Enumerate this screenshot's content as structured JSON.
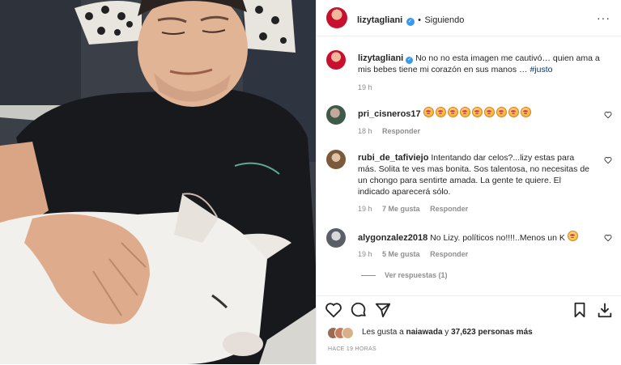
{
  "post": {
    "username": "lizytagliani",
    "follow_status": "Siguiendo",
    "separator": "•",
    "caption": "No no no esta imagen me cautivó… quien ama a mis bebes tiene mi corazón en sus manos … ",
    "hashtag": "#justo",
    "caption_time": "19 h"
  },
  "comments": [
    {
      "user": "pri_cisneros17",
      "text": "",
      "emoji_count": 9,
      "time": "18 h",
      "likes": "",
      "reply": "Responder"
    },
    {
      "user": "rubi_de_tafiviejo",
      "text": "Intentando dar celos?...lizy estas para más. Solita te ves mas bonita. Sos talentosa, no necesitas de un chongo para sentirte amada. La gente te quiere. El indicado aparecerá sólo.",
      "time": "19 h",
      "likes": "7 Me gusta",
      "reply": "Responder"
    },
    {
      "user": "alygonzalez2018",
      "text": "No Lizy. políticos no!!!!..Menos un K",
      "time": "19 h",
      "likes": "5 Me gusta",
      "reply": "Responder"
    }
  ],
  "view_replies": "Ver respuestas (1)",
  "likes_line": {
    "prefix": "Les gusta a ",
    "user": "naiawada",
    "middle": " y ",
    "count": "37,623 personas más"
  },
  "timestamp": "HACE 19 HORAS",
  "colors": {
    "link": "#00376b",
    "verified": "#3897f0",
    "muted": "#8e8e8e"
  }
}
